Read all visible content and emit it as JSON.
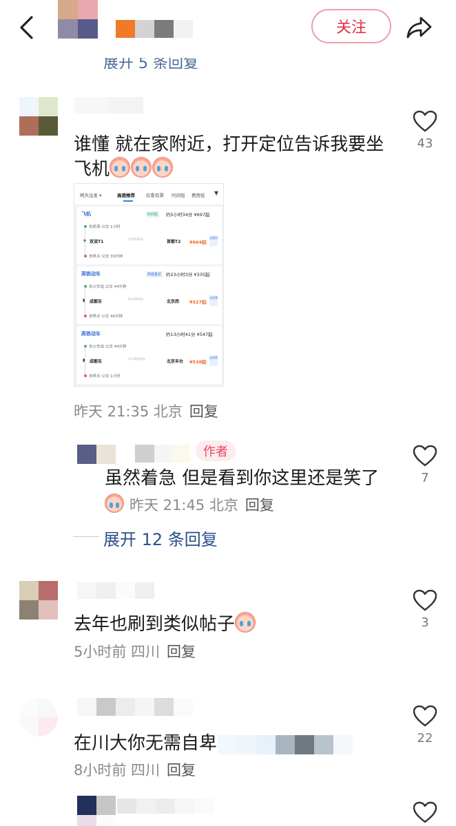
{
  "header": {
    "follow_label": "关注",
    "back_icon": "chevron-left-icon",
    "share_icon": "share-arrow-icon"
  },
  "faded_reply": "展开 5 条回复",
  "comments": [
    {
      "text": "谁懂 就在家附近，打开定位告诉我要坐飞机",
      "meta": "昨天 21:35 北京",
      "reply": "回复",
      "likes": "43"
    },
    {
      "badge": "作者",
      "text": "虽然着急 但是看到你这里还是笑了",
      "meta": "昨天 21:45 北京",
      "reply": "回复",
      "likes": "7"
    },
    {
      "text": "去年也刷到类似帖子",
      "meta": "5小时前 四川",
      "reply": "回复",
      "likes": "3"
    },
    {
      "text": "在川大你无需自卑",
      "meta": "8小时前 四川",
      "reply": "回复",
      "likes": "22"
    }
  ],
  "expand_replies": "展开 12 条回复",
  "screenshot": {
    "tabs": [
      "明天出发 ▾",
      "高德推荐",
      "仅看有票",
      "时间短",
      "费用低"
    ],
    "cards": [
      {
        "title": "飞机",
        "tag": "时间短",
        "duration": "约5小时34分 ¥697起",
        "line1": "去机场  公交  1小时",
        "from": "双流T1",
        "mid": "2小时35分",
        "to": "首都T2",
        "price": "¥664起",
        "chip": "去登机",
        "line3": "去终点  公交  39分钟"
      },
      {
        "title": "高铁动车",
        "tag": "高铁直达",
        "duration": "约23小时3分 ¥335起",
        "line1": "去火车站  公交  44分钟",
        "from": "成都东",
        "mid": "21小时4分",
        "to": "北京西",
        "price": "¥327起",
        "chip": "去抢票",
        "line3": "去终点  公交  46分钟"
      },
      {
        "title": "高铁动车",
        "tag": "",
        "duration": "约13小时41分 ¥547起",
        "line1": "去火车站  公交  44分钟",
        "from": "成都东",
        "mid": "11小时28分",
        "to": "北京丰台",
        "price": "¥538起",
        "chip": "去抢票",
        "line3": "去终点  公交  1小时"
      }
    ]
  },
  "colors": {
    "follow_border": "#e8a0a8",
    "follow_text": "#e02e4a",
    "link_blue": "#2b4f8a",
    "meta_gray": "#8a8a8a",
    "author_badge_bg": "#fdecef",
    "author_badge_text": "#e8465f"
  }
}
